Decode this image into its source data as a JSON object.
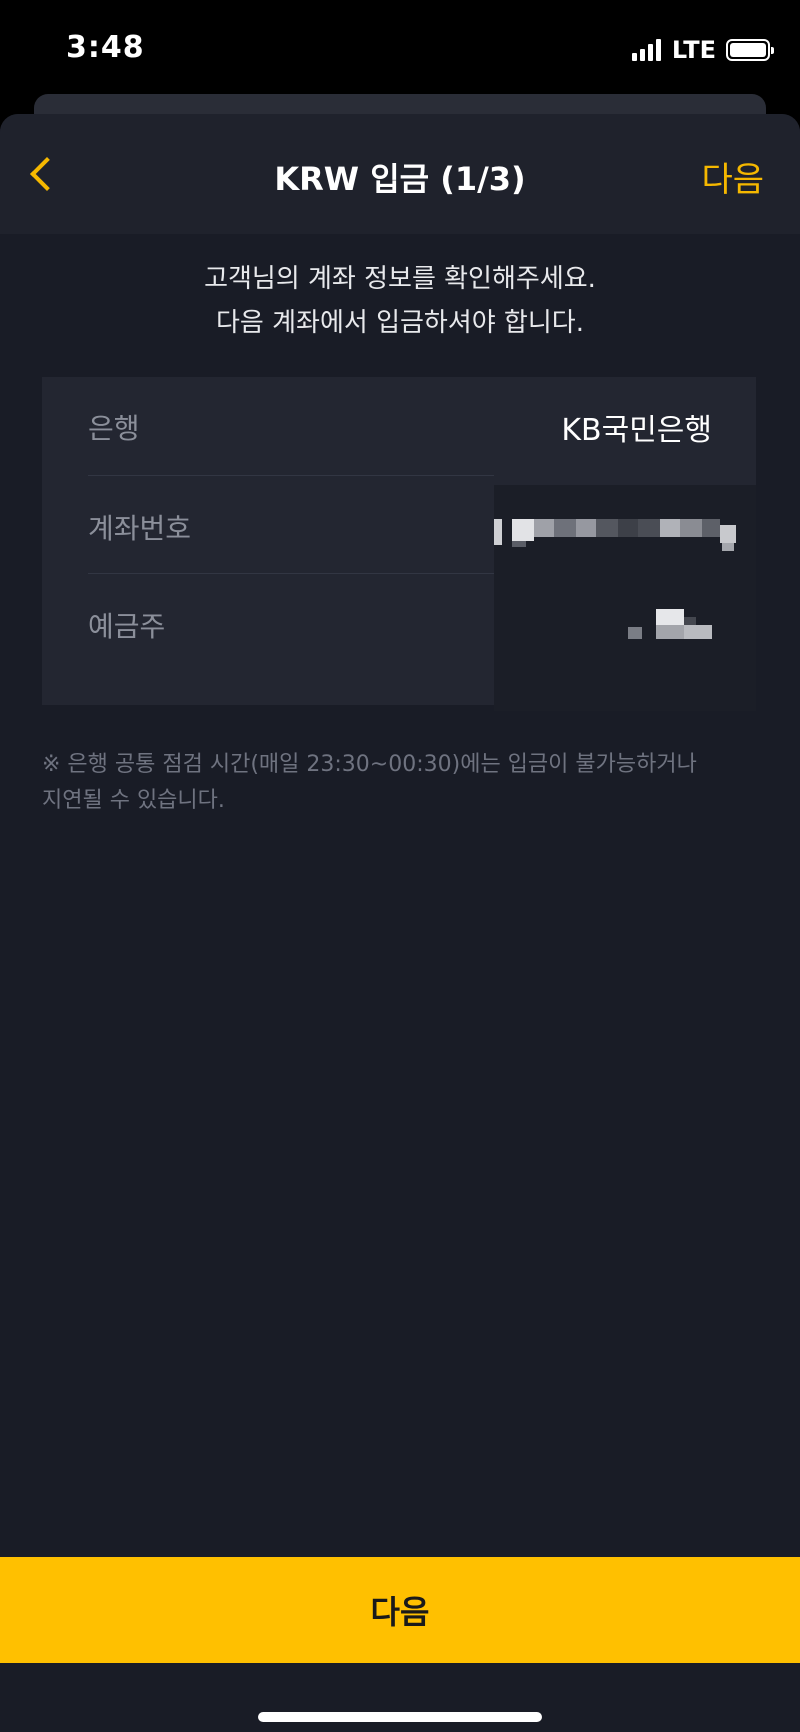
{
  "status_bar": {
    "time": "3:48",
    "network": "LTE",
    "icons": [
      "signal-icon",
      "battery-icon"
    ]
  },
  "nav": {
    "title": "KRW 입금 (1/3)",
    "next_label": "다음",
    "back_icon": "chevron-left-icon"
  },
  "intro": {
    "line1": "고객님의 계좌 정보를 확인해주세요.",
    "line2": "다음 계좌에서 입금하셔야 합니다."
  },
  "account": {
    "rows": [
      {
        "label": "은행",
        "value": "KB국민은행"
      },
      {
        "label": "계좌번호",
        "value": ""
      },
      {
        "label": "예금주",
        "value": ""
      }
    ]
  },
  "note": {
    "line1": "※ 은행 공통 점검 시간(매일 23:30~00:30)에는 입금이 불가능하거나",
    "line2": "지연될 수 있습니다."
  },
  "bottom_button": {
    "label": "다음"
  },
  "colors": {
    "accent": "#f5b800",
    "button": "#ffc000",
    "background": "#191c26",
    "card": "#232631"
  }
}
